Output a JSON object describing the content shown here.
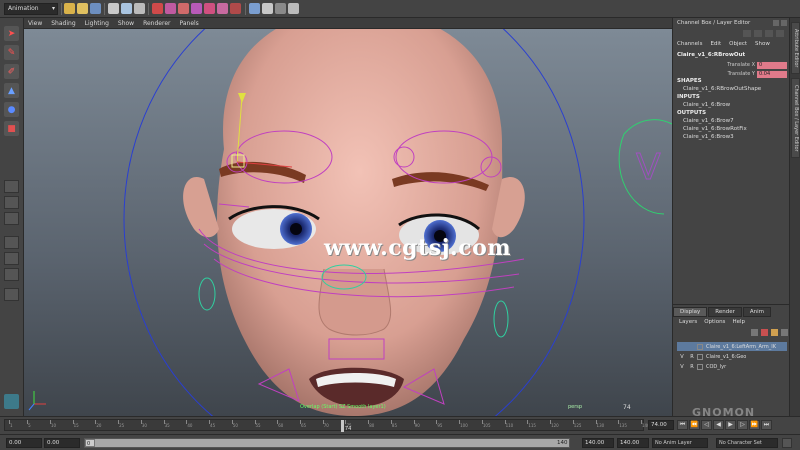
{
  "shelf": {
    "mode": "Animation"
  },
  "viewport": {
    "menu": [
      "View",
      "Shading",
      "Lighting",
      "Show",
      "Renderer",
      "Panels"
    ],
    "watermark": "www.cgtsj.com",
    "status": "Overlap (Start) SZ Smooth layer1)",
    "camera": "persp",
    "frame": "74"
  },
  "channel_box": {
    "title": "Channel Box / Layer Editor",
    "menu": [
      "Channels",
      "Edit",
      "Object",
      "Show"
    ],
    "object": "Claire_v1_6:RBrowOut",
    "attributes": [
      {
        "label": "Translate X",
        "value": "0"
      },
      {
        "label": "Translate Y",
        "value": "0.04"
      }
    ],
    "shapes_header": "SHAPES",
    "shapes": [
      "Claire_v1_6:RBrowOutShape"
    ],
    "inputs_header": "INPUTS",
    "inputs": [
      "Claire_v1_6:Brow"
    ],
    "outputs_header": "OUTPUTS",
    "outputs": [
      "Claire_v1_6:Brow7",
      "Claire_v1_6:BrowRotFix",
      "Claire_v1_6:Brow3"
    ]
  },
  "side_tabs": [
    "Attribute Editor",
    "Channel Box / Layer Editor"
  ],
  "layer_editor": {
    "tabs": [
      "Display",
      "Render",
      "Anim"
    ],
    "menu": [
      "Layers",
      "Options",
      "Help"
    ],
    "layers": [
      {
        "v": "",
        "r": "",
        "name": "Claire_v1_6:LeftArm_Arm_IK",
        "selected": true
      },
      {
        "v": "V",
        "r": "R",
        "name": "Claire_v1_6:Geo",
        "selected": false
      },
      {
        "v": "V",
        "r": "R",
        "name": "COD_lyr",
        "selected": false
      }
    ]
  },
  "time_slider": {
    "ticks": [
      "1",
      "5",
      "10",
      "15",
      "20",
      "25",
      "30",
      "35",
      "40",
      "45",
      "50",
      "55",
      "60",
      "65",
      "70",
      "75",
      "80",
      "85",
      "90",
      "95",
      "100",
      "105",
      "110",
      "115",
      "120",
      "125",
      "130",
      "135",
      "140"
    ],
    "current_frame": "74",
    "current_frame_field": "74.00"
  },
  "range_slider": {
    "start_time": "0.00",
    "playback_start": "0.00",
    "range_start": "0",
    "range_end_label": "140",
    "playback_end": "140.00",
    "end_time": "140.00",
    "anim_layer": "No Anim Layer",
    "character_set": "No Character Set"
  },
  "colors": {
    "accent_red": "#e07a8a",
    "selection_blue": "#5d7a9e",
    "control_magenta": "#c040c0"
  }
}
